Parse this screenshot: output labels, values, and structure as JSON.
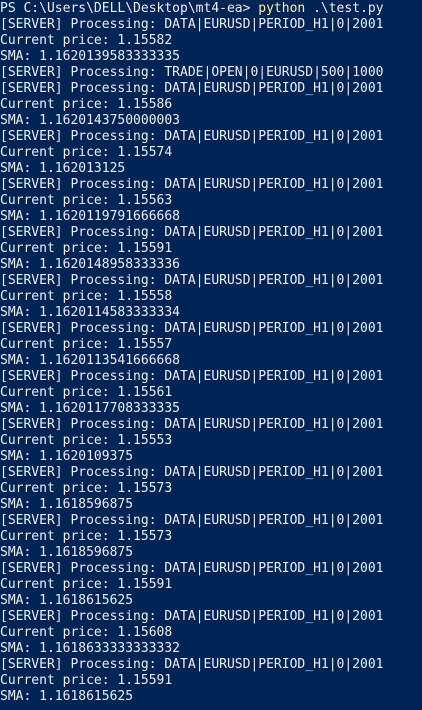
{
  "prompt": {
    "path": "PS C:\\Users\\DELL\\Desktop\\mt4-ea> ",
    "command": "python",
    "args": " .\\test.py"
  },
  "lines": [
    "[SERVER] Processing: DATA|EURUSD|PERIOD_H1|0|2001",
    "Current price: 1.15582",
    "SMA: 1.1620139583333335",
    "[SERVER] Processing: TRADE|OPEN|0|EURUSD|500|1000",
    "[SERVER] Processing: DATA|EURUSD|PERIOD_H1|0|2001",
    "Current price: 1.15586",
    "SMA: 1.1620143750000003",
    "[SERVER] Processing: DATA|EURUSD|PERIOD_H1|0|2001",
    "Current price: 1.15574",
    "SMA: 1.162013125",
    "[SERVER] Processing: DATA|EURUSD|PERIOD_H1|0|2001",
    "Current price: 1.15563",
    "SMA: 1.1620119791666668",
    "[SERVER] Processing: DATA|EURUSD|PERIOD_H1|0|2001",
    "Current price: 1.15591",
    "SMA: 1.1620148958333336",
    "[SERVER] Processing: DATA|EURUSD|PERIOD_H1|0|2001",
    "Current price: 1.15558",
    "SMA: 1.1620114583333334",
    "[SERVER] Processing: DATA|EURUSD|PERIOD_H1|0|2001",
    "Current price: 1.15557",
    "SMA: 1.1620113541666668",
    "[SERVER] Processing: DATA|EURUSD|PERIOD_H1|0|2001",
    "Current price: 1.15561",
    "SMA: 1.1620117708333335",
    "[SERVER] Processing: DATA|EURUSD|PERIOD_H1|0|2001",
    "Current price: 1.15553",
    "SMA: 1.1620109375",
    "[SERVER] Processing: DATA|EURUSD|PERIOD_H1|0|2001",
    "Current price: 1.15573",
    "SMA: 1.1618596875",
    "[SERVER] Processing: DATA|EURUSD|PERIOD_H1|0|2001",
    "Current price: 1.15573",
    "SMA: 1.1618596875",
    "[SERVER] Processing: DATA|EURUSD|PERIOD_H1|0|2001",
    "Current price: 1.15591",
    "SMA: 1.1618615625",
    "[SERVER] Processing: DATA|EURUSD|PERIOD_H1|0|2001",
    "Current price: 1.15608",
    "SMA: 1.1618633333333332",
    "[SERVER] Processing: DATA|EURUSD|PERIOD_H1|0|2001",
    "Current price: 1.15591",
    "SMA: 1.1618615625"
  ],
  "colors": {
    "background": "#012456",
    "foreground": "#eeedf0",
    "command": "#f9f1a5"
  }
}
